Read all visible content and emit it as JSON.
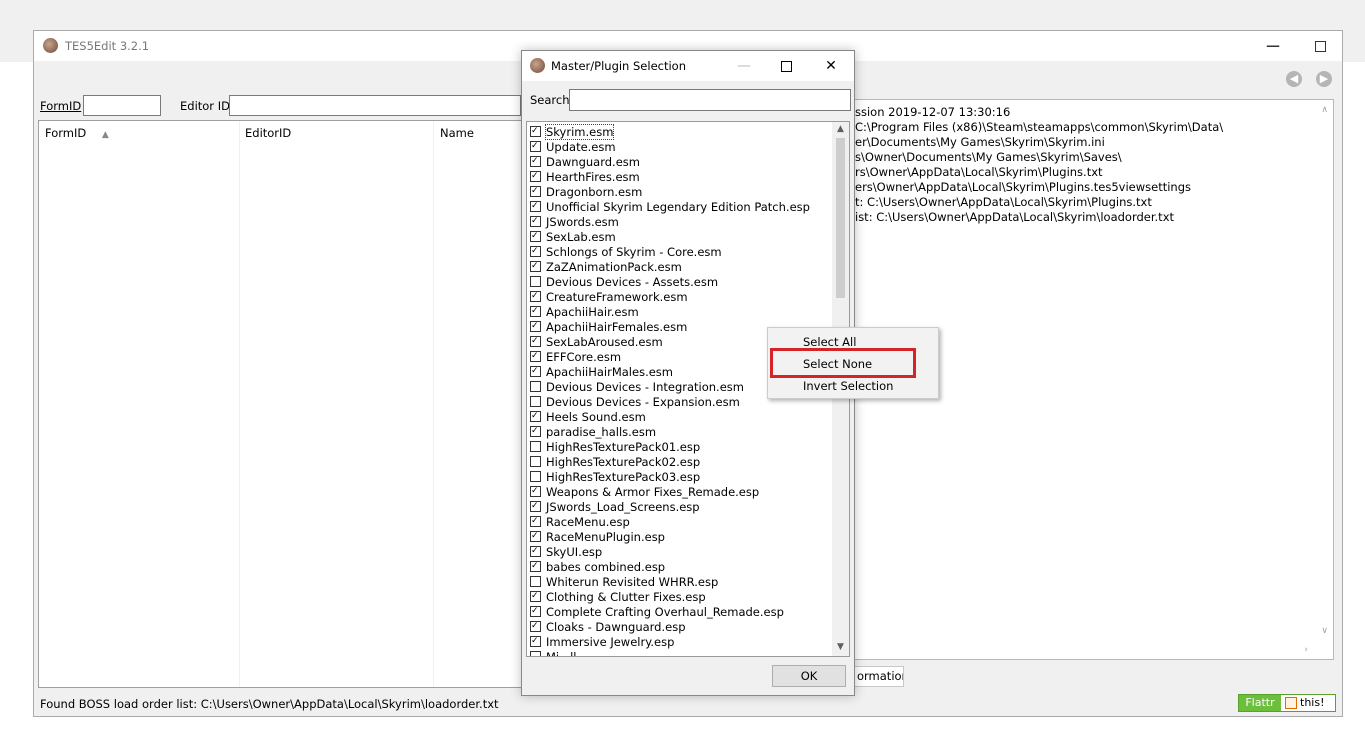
{
  "app": {
    "title": "TES5Edit 3.2.1",
    "formid_label": "FormID",
    "editorid_label": "Editor ID",
    "columns": [
      "FormID",
      "EditorID",
      "Name"
    ],
    "sort_icon": "sort-ascending-icon",
    "messages": [
      "ssion 2019-12-07 13:30:16",
      "C:\\Program Files (x86)\\Steam\\steamapps\\common\\Skyrim\\Data\\",
      "er\\Documents\\My Games\\Skyrim\\Skyrim.ini",
      "s\\Owner\\Documents\\My Games\\Skyrim\\Saves\\",
      "rs\\Owner\\AppData\\Local\\Skyrim\\Plugins.txt",
      "ers\\Owner\\AppData\\Local\\Skyrim\\Plugins.tes5viewsettings",
      "t: C:\\Users\\Owner\\AppData\\Local\\Skyrim\\Plugins.txt",
      "ist: C:\\Users\\Owner\\AppData\\Local\\Skyrim\\loadorder.txt"
    ],
    "tab_information": "ormation",
    "status": "Found BOSS load order list: C:\\Users\\Owner\\AppData\\Local\\Skyrim\\loadorder.txt",
    "flattr_left": "Flattr",
    "flattr_right": "this!"
  },
  "dialog": {
    "title": "Master/Plugin Selection",
    "search_label": "Search",
    "search_value": "",
    "ok_label": "OK",
    "plugins": [
      {
        "name": "Skyrim.esm",
        "checked": true
      },
      {
        "name": "Update.esm",
        "checked": true
      },
      {
        "name": "Dawnguard.esm",
        "checked": true
      },
      {
        "name": "HearthFires.esm",
        "checked": true
      },
      {
        "name": "Dragonborn.esm",
        "checked": true
      },
      {
        "name": "Unofficial Skyrim Legendary Edition Patch.esp",
        "checked": true
      },
      {
        "name": "JSwords.esm",
        "checked": true
      },
      {
        "name": "SexLab.esm",
        "checked": true
      },
      {
        "name": "Schlongs of Skyrim - Core.esm",
        "checked": true
      },
      {
        "name": "ZaZAnimationPack.esm",
        "checked": true
      },
      {
        "name": "Devious Devices - Assets.esm",
        "checked": false
      },
      {
        "name": "CreatureFramework.esm",
        "checked": true
      },
      {
        "name": "ApachiiHair.esm",
        "checked": true
      },
      {
        "name": "ApachiiHairFemales.esm",
        "checked": true
      },
      {
        "name": "SexLabAroused.esm",
        "checked": true
      },
      {
        "name": "EFFCore.esm",
        "checked": true
      },
      {
        "name": "ApachiiHairMales.esm",
        "checked": true
      },
      {
        "name": "Devious Devices - Integration.esm",
        "checked": false
      },
      {
        "name": "Devious Devices - Expansion.esm",
        "checked": false
      },
      {
        "name": "Heels Sound.esm",
        "checked": true
      },
      {
        "name": "paradise_halls.esm",
        "checked": true
      },
      {
        "name": "HighResTexturePack01.esp",
        "checked": false
      },
      {
        "name": "HighResTexturePack02.esp",
        "checked": false
      },
      {
        "name": "HighResTexturePack03.esp",
        "checked": false
      },
      {
        "name": "Weapons & Armor Fixes_Remade.esp",
        "checked": true
      },
      {
        "name": "JSwords_Load_Screens.esp",
        "checked": true
      },
      {
        "name": "RaceMenu.esp",
        "checked": true
      },
      {
        "name": "RaceMenuPlugin.esp",
        "checked": true
      },
      {
        "name": "SkyUI.esp",
        "checked": true
      },
      {
        "name": "babes combined.esp",
        "checked": true
      },
      {
        "name": "Whiterun Revisited WHRR.esp",
        "checked": false
      },
      {
        "name": "Clothing & Clutter Fixes.esp",
        "checked": true
      },
      {
        "name": "Complete Crafting Overhaul_Remade.esp",
        "checked": true
      },
      {
        "name": "Cloaks - Dawnguard.esp",
        "checked": true
      },
      {
        "name": "Immersive Jewelry.esp",
        "checked": true
      },
      {
        "name": "Mi...ll...",
        "checked": false
      }
    ]
  },
  "context_menu": {
    "items": [
      "Select All",
      "Select None",
      "Invert Selection"
    ],
    "highlighted": "Select None",
    "highlight_color": "#d42426"
  }
}
